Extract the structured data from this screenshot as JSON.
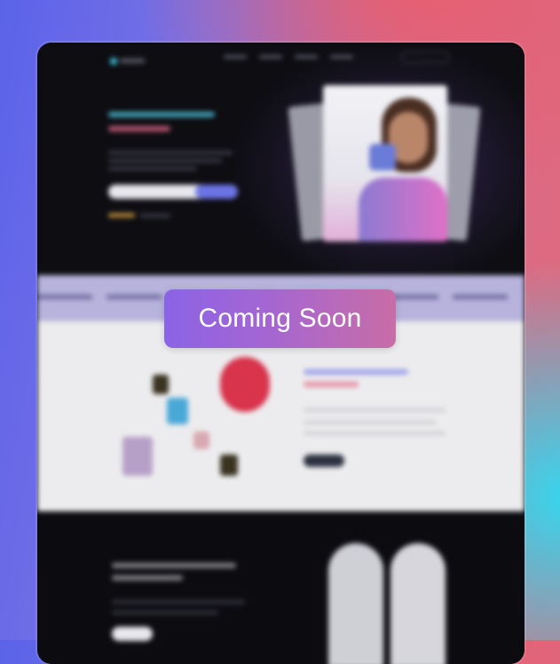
{
  "overlay": {
    "badge_text": "Coming Soon"
  },
  "colors": {
    "accent_cyan": "#4fc9e0",
    "accent_pink": "#e46a88",
    "accent_purple": "#6c74e6",
    "badge_start": "#8b63e6",
    "badge_end": "#c86da6"
  },
  "preview": {
    "state": "blurred"
  }
}
